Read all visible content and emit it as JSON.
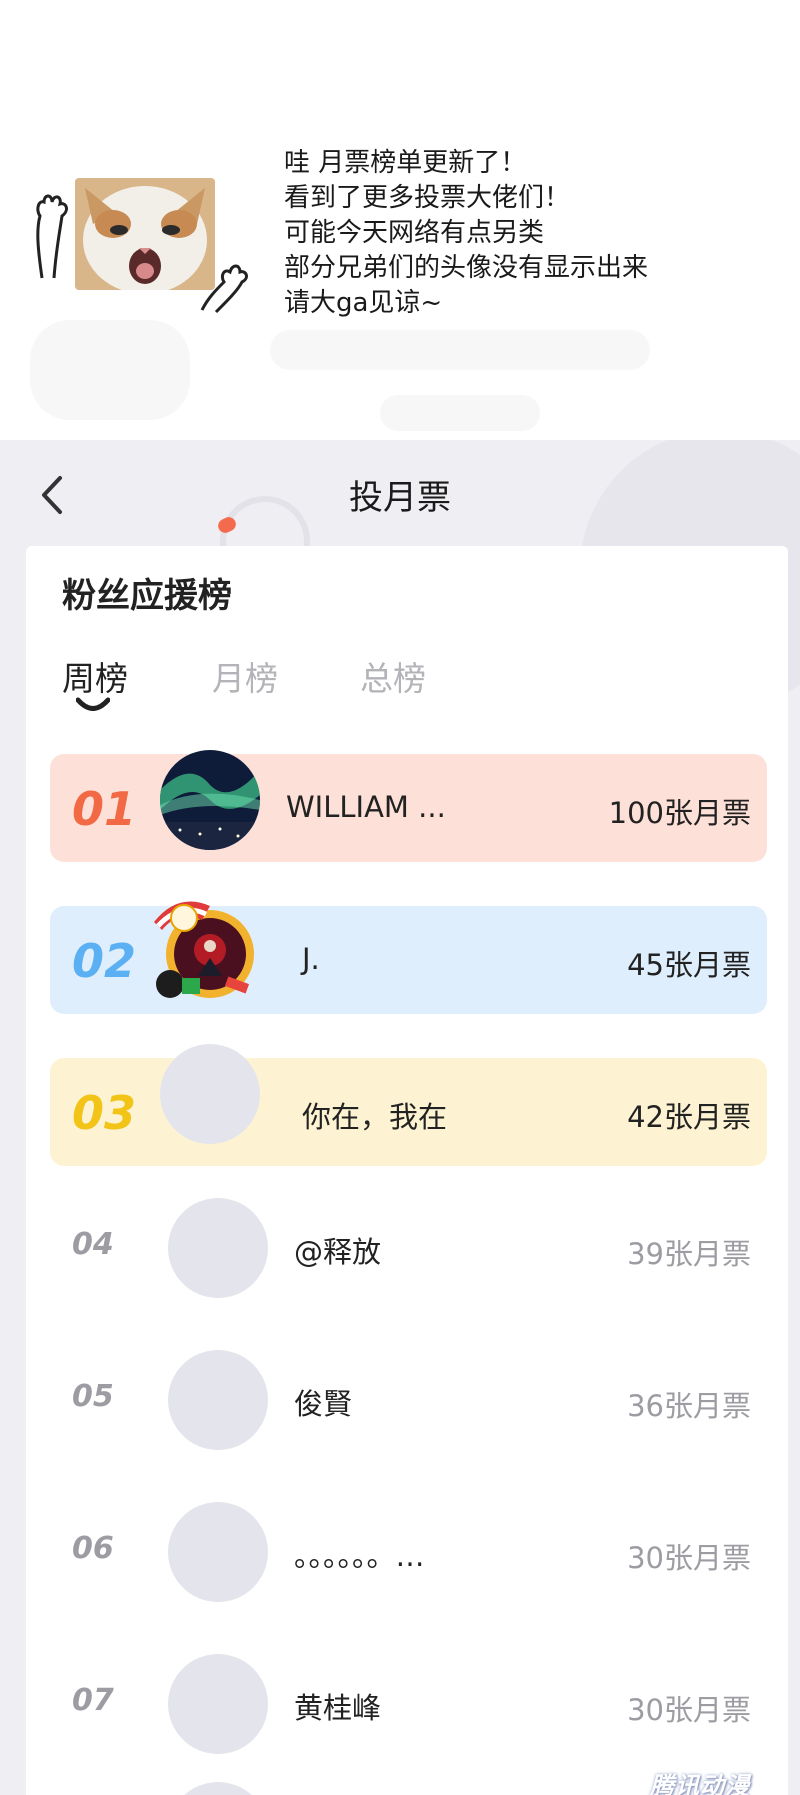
{
  "caption": {
    "lines": [
      "哇 月票榜单更新了！",
      "看到了更多投票大佬们！",
      "可能今天网络有点另类",
      "部分兄弟们的头像没有显示出来",
      "请大ga见谅~"
    ]
  },
  "header": {
    "title": "投月票",
    "back_icon": "chevron-left-icon"
  },
  "panel": {
    "title": "粉丝应援榜",
    "tabs": [
      {
        "label": "周榜",
        "active": true
      },
      {
        "label": "月榜",
        "active": false
      },
      {
        "label": "总榜",
        "active": false
      }
    ]
  },
  "ranking": [
    {
      "rank": "01",
      "name": "WILLIAM ...",
      "votes": "100张月票",
      "color": "#f26a45"
    },
    {
      "rank": "02",
      "name": "J.",
      "votes": "45张月票",
      "color": "#5ab0f2"
    },
    {
      "rank": "03",
      "name": "你在，我在",
      "votes": "42张月票",
      "color": "#f2c418"
    },
    {
      "rank": "04",
      "name": "@释放",
      "votes": "39张月票"
    },
    {
      "rank": "05",
      "name": "俊賢",
      "votes": "36张月票"
    },
    {
      "rank": "06",
      "name": "。。。。。。…",
      "votes": "30张月票"
    },
    {
      "rank": "07",
      "name": "黄桂峰",
      "votes": "30张月票"
    }
  ],
  "watermark": "腾讯动漫"
}
